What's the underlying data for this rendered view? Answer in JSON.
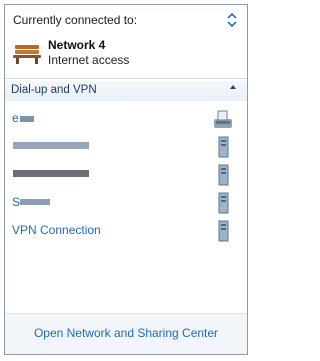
{
  "panel": {
    "heading": "Currently connected to:"
  },
  "active_network": {
    "name": "Network  4",
    "status": "Internet access",
    "icon": "bench-network-icon"
  },
  "group": {
    "title": "Dial-up and VPN",
    "collapse_icon": "chevron-up-icon"
  },
  "connections": [
    {
      "label": "e",
      "icon": "fax-modem-icon"
    },
    {
      "label": "",
      "icon": "server-icon"
    },
    {
      "label": "",
      "icon": "server-icon"
    },
    {
      "label": "S",
      "icon": "server-icon"
    },
    {
      "label": "VPN Connection",
      "icon": "server-icon"
    }
  ],
  "footer": {
    "link": "Open Network and Sharing Center"
  },
  "colors": {
    "link": "#1f6bb5",
    "border": "#8f9aa6"
  }
}
